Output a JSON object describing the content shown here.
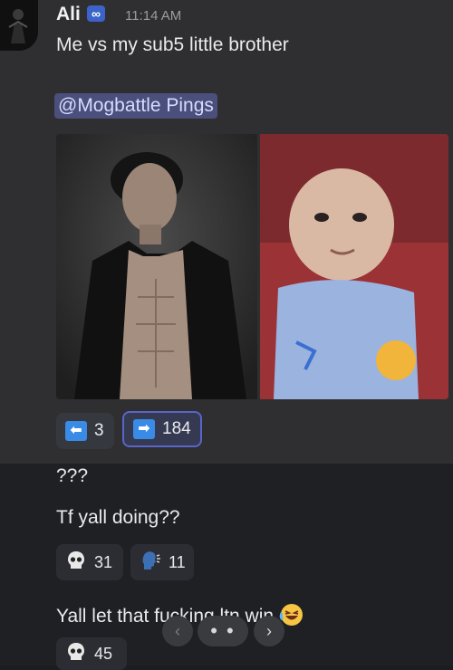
{
  "message": {
    "author": "Ali",
    "role_icon": "∞",
    "timestamp": "11:14 AM",
    "text": "Me vs my sub5 little brother",
    "mention": "@Mogbattle Pings",
    "attachments": [
      "shirtless-man-photo",
      "baby-photo"
    ],
    "votes": [
      {
        "icon": "arrow-left-icon",
        "count": "3"
      },
      {
        "icon": "arrow-right-icon",
        "count": "184"
      }
    ]
  },
  "followups": {
    "line1": "???",
    "line2": "Tf yall doing??",
    "reactions": [
      {
        "icon": "skull-icon",
        "count": "31"
      },
      {
        "icon": "speaking-head-icon",
        "count": "11"
      }
    ],
    "line3": "Yall let that fucking ltn win",
    "last_reaction": {
      "icon": "skull-icon",
      "count": "45"
    }
  },
  "pager": {
    "prev": "‹",
    "dots": "• •",
    "next": "›"
  },
  "colors": {
    "accent": "#5865c9",
    "mention_bg": "#4a4f7c",
    "vote_arrow": "#3a8be6"
  }
}
